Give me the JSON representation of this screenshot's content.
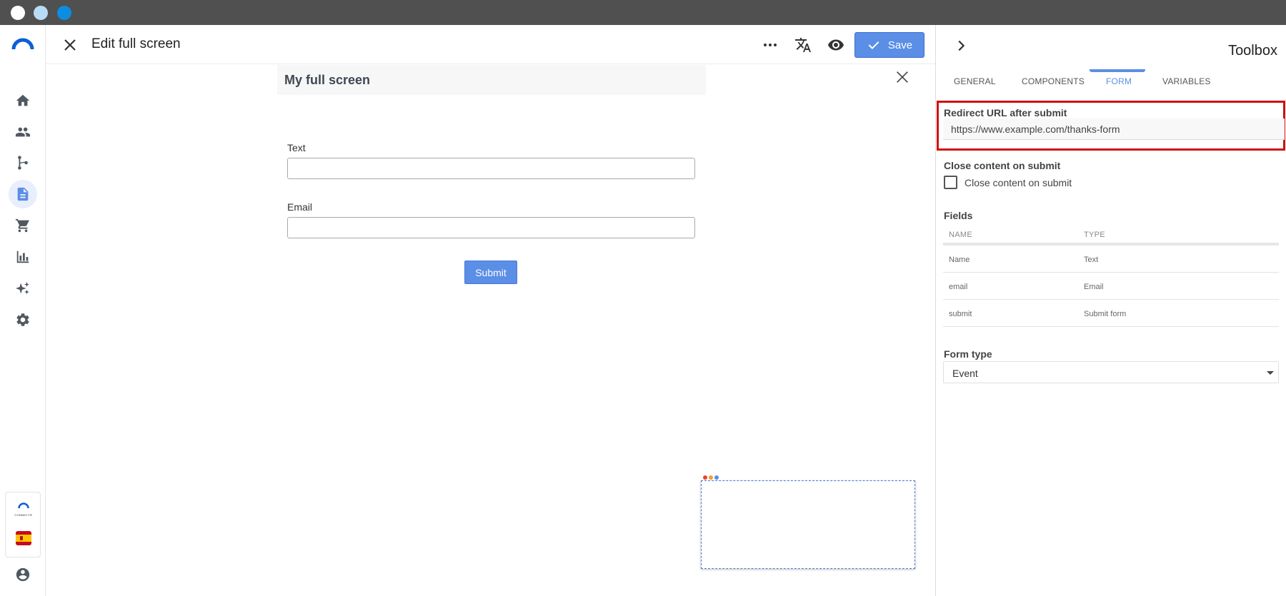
{
  "header": {
    "title": "Edit full screen",
    "save_label": "Save"
  },
  "canvas": {
    "screen_title": "My full screen",
    "fields": [
      {
        "label": "Text"
      },
      {
        "label": "Email"
      }
    ],
    "submit_label": "Submit"
  },
  "sidebar": {
    "items": [
      {
        "icon": "home-icon"
      },
      {
        "icon": "people-icon"
      },
      {
        "icon": "flow-icon"
      },
      {
        "icon": "document-icon",
        "active": true
      },
      {
        "icon": "cart-icon"
      },
      {
        "icon": "chart-icon"
      },
      {
        "icon": "sparkles-icon"
      },
      {
        "icon": "gear-icon"
      }
    ],
    "brand_text": "CONNECTIF"
  },
  "toolbox": {
    "title": "Toolbox",
    "tabs": [
      {
        "label": "GENERAL"
      },
      {
        "label": "COMPONENTS"
      },
      {
        "label": "FORM",
        "active": true
      },
      {
        "label": "VARIABLES"
      }
    ],
    "redirect": {
      "label": "Redirect URL after submit",
      "value": "https://www.example.com/thanks-form"
    },
    "close_content": {
      "label": "Close content on submit",
      "checkbox_label": "Close content on submit",
      "checked": false
    },
    "fields": {
      "label": "Fields",
      "columns": [
        "NAME",
        "TYPE"
      ],
      "rows": [
        {
          "name": "Name",
          "type": "Text"
        },
        {
          "name": "email",
          "type": "Email"
        },
        {
          "name": "submit",
          "type": "Submit form"
        }
      ]
    },
    "form_type": {
      "label": "Form type",
      "value": "Event"
    }
  },
  "colors": {
    "accent": "#5b8ee6",
    "highlight": "#d01010",
    "chrome": "#505050"
  }
}
